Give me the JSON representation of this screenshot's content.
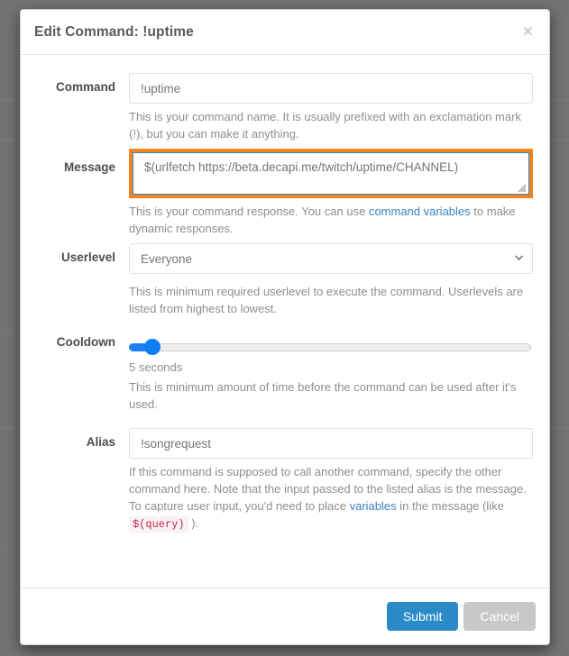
{
  "backdrop": {
    "color": "#737373"
  },
  "modal": {
    "title": "Edit Command: !uptime",
    "close_label": "×",
    "fields": {
      "command": {
        "label": "Command",
        "value": "!uptime",
        "placeholder": "!uptime",
        "help_before": "This is your command name. It is usually prefixed with an exclamation mark (!), but you can make it anything."
      },
      "message": {
        "label": "Message",
        "value": "$(urlfetch https://beta.decapi.me/twitch/uptime/CHANNEL)",
        "placeholder": "$(urlfetch https://beta.decapi.me/twitch/uptime/CHANNEL)",
        "help_before": "This is your command response. You can use ",
        "help_link": "command variables",
        "help_after": " to make dynamic responses.",
        "highlight_color": "#f5821f",
        "focus_border_color": "#2e8ac9"
      },
      "userlevel": {
        "label": "Userlevel",
        "selected": "Everyone",
        "options": [
          "Everyone"
        ],
        "help": "This is minimum required userlevel to execute the command. Userlevels are listed from highest to lowest."
      },
      "cooldown": {
        "label": "Cooldown",
        "value_text": "5 seconds",
        "help": "This is minimum amount of time before the command can be used after it's used.",
        "fill_color": "#1e7ff5",
        "percent": 4
      },
      "alias": {
        "label": "Alias",
        "value": "!songrequest",
        "placeholder": "!songrequest",
        "help_part1": "If this command is supposed to call another command, specify the other command here. Note that the input passed to the listed alias is the message. To capture user input, you'd need to place ",
        "help_link": "variables",
        "help_part2": " in the message (like ",
        "help_code": "$(query)",
        "help_part3": " )."
      }
    },
    "footer": {
      "submit_label": "Submit",
      "cancel_label": "Cancel",
      "submit_color": "#2b8bc8",
      "cancel_color": "#c8c8c8"
    }
  }
}
